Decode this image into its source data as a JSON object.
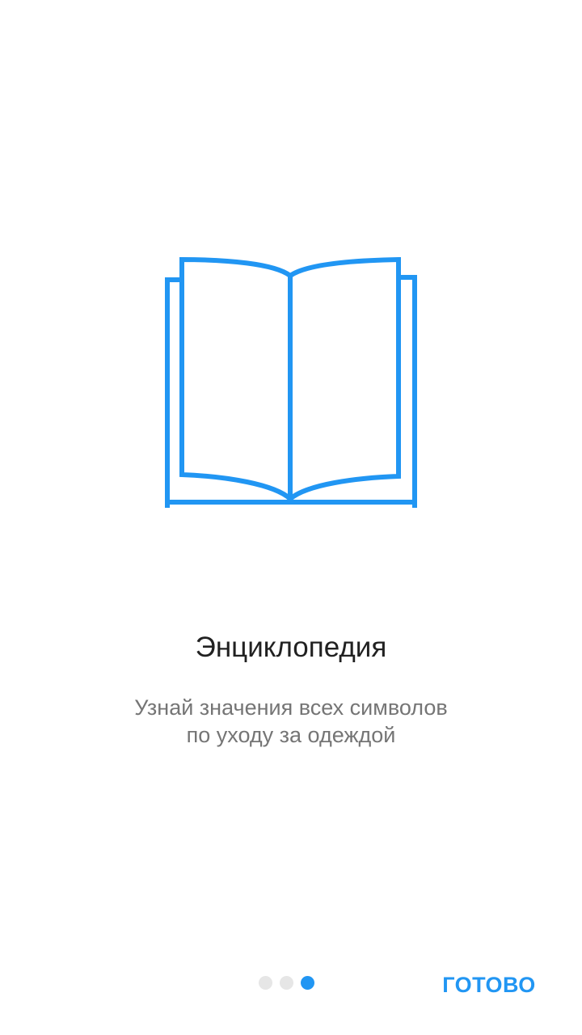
{
  "onboarding": {
    "illustration_icon": "open-book-icon",
    "title": "Энциклопедия",
    "subtitle_line1": "Узнай значения всех символов",
    "subtitle_line2": "по уходу за одеждой"
  },
  "pager": {
    "total_pages": 3,
    "current_page": 3
  },
  "footer": {
    "done_label": "ГОТОВО"
  },
  "colors": {
    "accent": "#2196f3",
    "title_text": "#212121",
    "subtitle_text": "#757575",
    "inactive_dot": "#e6e6e6",
    "background": "#ffffff"
  }
}
